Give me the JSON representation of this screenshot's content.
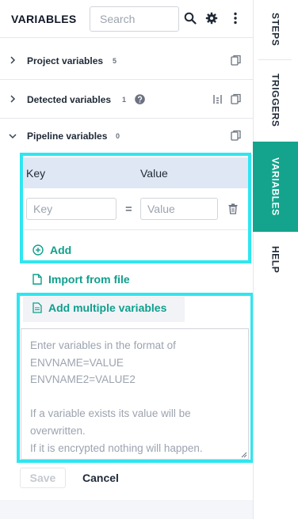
{
  "header": {
    "title": "VARIABLES",
    "search_placeholder": "Search"
  },
  "sections": [
    {
      "label": "Project variables",
      "count": "5",
      "expanded": false
    },
    {
      "label": "Detected variables",
      "count": "1",
      "expanded": false
    },
    {
      "label": "Pipeline variables",
      "count": "0",
      "expanded": true
    }
  ],
  "kv_table": {
    "key_header": "Key",
    "value_header": "Value",
    "key_placeholder": "Key",
    "value_placeholder": "Value",
    "equals": "="
  },
  "actions": {
    "add": "Add",
    "import": "Import from file",
    "add_multiple": "Add multiple variables"
  },
  "multi_placeholder": "Enter variables in the format of\nENVNAME=VALUE\nENVNAME2=VALUE2\n\nIf a variable exists its value will be\noverwritten.\nIf it is encrypted nothing will happen.",
  "buttons": {
    "save": "Save",
    "cancel": "Cancel"
  },
  "side_tabs": [
    {
      "label": "STEPS",
      "active": false
    },
    {
      "label": "TRIGGERS",
      "active": false
    },
    {
      "label": "VARIABLES",
      "active": true
    },
    {
      "label": "HELP",
      "active": false
    }
  ],
  "colors": {
    "accent": "#14a48d",
    "link": "#0f9f8c",
    "highlight": "#2ee6f0"
  }
}
